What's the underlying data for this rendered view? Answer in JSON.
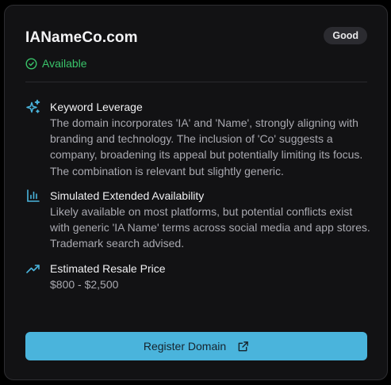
{
  "domain": {
    "name": "IANameCo.com",
    "rating": "Good",
    "status": "Available"
  },
  "sections": [
    {
      "icon": "sparkles-icon",
      "title": "Keyword Leverage",
      "text": "The domain incorporates 'IA' and 'Name', strongly aligning with branding and technology. The inclusion of 'Co' suggests a company, broadening its appeal but potentially limiting its focus. The combination is relevant but slightly generic."
    },
    {
      "icon": "bar-chart-icon",
      "title": "Simulated Extended Availability",
      "text": "Likely available on most platforms, but potential conflicts exist with generic 'IA Name' terms across social media and app stores. Trademark search advised."
    },
    {
      "icon": "trending-up-icon",
      "title": "Estimated Resale Price",
      "text": "$800 - $2,500"
    }
  ],
  "action": {
    "register_label": "Register Domain"
  },
  "colors": {
    "accent": "#4ab4dc",
    "available": "#39c46a",
    "card_bg": "#121214"
  }
}
